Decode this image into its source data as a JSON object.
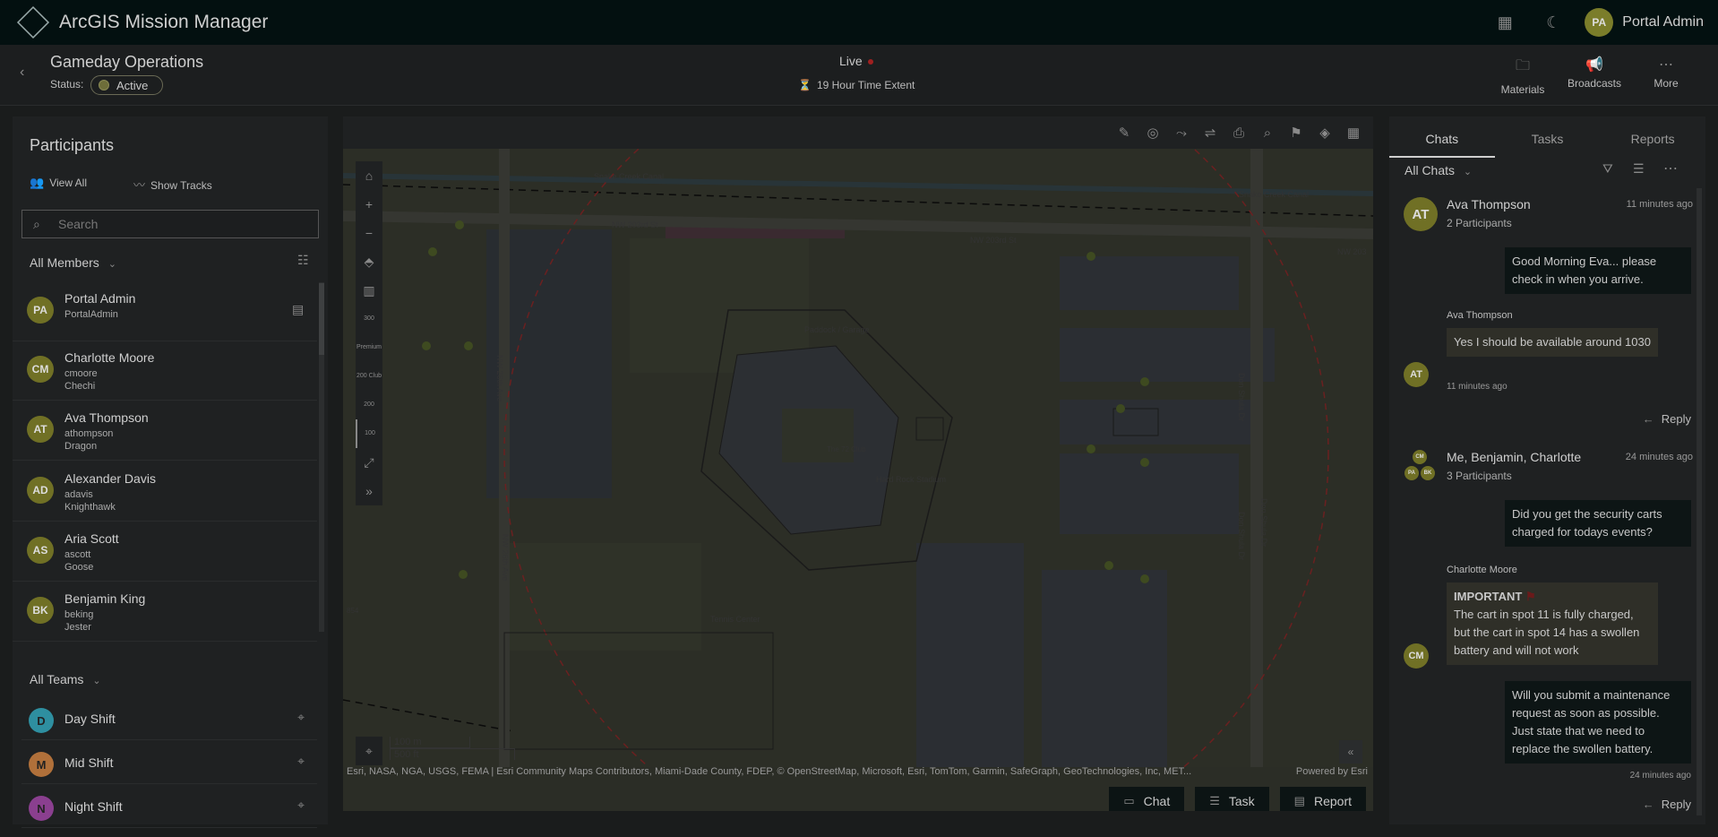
{
  "app": {
    "title": "ArcGIS Mission Manager",
    "user_initials": "PA",
    "user_name": "Portal Admin"
  },
  "mission": {
    "title": "Gameday Operations",
    "status_label": "Status:",
    "status_value": "Active",
    "live_label": "Live",
    "time_extent": "19 Hour Time Extent"
  },
  "sub_actions": [
    {
      "label": "Materials",
      "icon": "folder-icon"
    },
    {
      "label": "Broadcasts",
      "icon": "megaphone-icon"
    },
    {
      "label": "More",
      "icon": "more-icon"
    }
  ],
  "participants": {
    "title": "Participants",
    "view_all": "View All",
    "show_tracks": "Show Tracks",
    "search_placeholder": "Search",
    "filter_label": "All Members",
    "members": [
      {
        "initials": "PA",
        "name": "Portal Admin",
        "user": "PortalAdmin",
        "callsign": ""
      },
      {
        "initials": "CM",
        "name": "Charlotte Moore",
        "user": "cmoore",
        "callsign": "Chechi"
      },
      {
        "initials": "AT",
        "name": "Ava Thompson",
        "user": "athompson",
        "callsign": "Dragon"
      },
      {
        "initials": "AD",
        "name": "Alexander Davis",
        "user": "adavis",
        "callsign": "Knighthawk"
      },
      {
        "initials": "AS",
        "name": "Aria Scott",
        "user": "ascott",
        "callsign": "Goose"
      },
      {
        "initials": "BK",
        "name": "Benjamin King",
        "user": "beking",
        "callsign": "Jester"
      }
    ],
    "teams_label": "All Teams",
    "teams": [
      {
        "initial": "D",
        "name": "Day Shift",
        "color": "#2e8fa0"
      },
      {
        "initial": "M",
        "name": "Mid Shift",
        "color": "#b0703a"
      },
      {
        "initial": "N",
        "name": "Night Shift",
        "color": "#8a3f8f"
      }
    ]
  },
  "map": {
    "attribution": "Esri, NASA, NGA, USGS, FEMA | Esri Community Maps Contributors, Miami-Dade County, FDEP, © OpenStreetMap, Microsoft, Esri, TomTom, Garmin, SafeGraph, GeoTechnologies, Inc, MET...",
    "powered_by": "Powered by Esri",
    "scale_m": "100 m",
    "scale_ft": "500 ft",
    "labels": {
      "canal_1": "Snake Creek Canal",
      "canal_2": "Snake Creek Canal",
      "street_1": "NW 203rd St",
      "street_2": "NW 203rd St",
      "street_3": "NW 203",
      "paddock": "Paddock / Garage",
      "stadium": "Hard Rock Stadium",
      "tennis": "Tennis Center",
      "ave_1": "NW 26th Ave",
      "ave_2": "NW 26th Ave",
      "dr_1": "Don Shula Dr",
      "dr_2": "Don Shula Dr",
      "dr_3": "Don Shula Dr",
      "club": "The 72 Club",
      "road_num": "854"
    },
    "floors": [
      "300",
      "Premium",
      "200 Club",
      "200",
      "100"
    ],
    "buttons": [
      {
        "label": "Chat",
        "icon": "chat-icon"
      },
      {
        "label": "Task",
        "icon": "task-list-icon"
      },
      {
        "label": "Report",
        "icon": "report-icon"
      }
    ]
  },
  "chats": {
    "tabs": [
      "Chats",
      "Tasks",
      "Reports"
    ],
    "filter_label": "All Chats",
    "thread1": {
      "initials": "AT",
      "name": "Ava Thompson",
      "sub": "2 Participants",
      "time": "11 minutes ago",
      "msg_out": "Good Morning Eva... please check in when you arrive.",
      "sender": "Ava Thompson",
      "msg_in": "Yes I should be available around 1030",
      "msg_in_time": "11 minutes ago",
      "reply": "Reply"
    },
    "thread2": {
      "initials": [
        "CM",
        "PA",
        "BK"
      ],
      "name": "Me, Benjamin, Charlotte",
      "sub": "3 Participants",
      "time": "24 minutes ago",
      "msg_out": "Did you get the security carts charged for todays events?",
      "sender": "Charlotte Moore",
      "important": "IMPORTANT",
      "msg_in": "The cart in spot 11 is fully charged, but the cart in spot 14 has a swollen battery and will not work",
      "sender_initials": "CM",
      "msg_out2": "Will you submit a maintenance request as soon as possible. Just state that we need to replace the swollen battery.",
      "msg_out2_time": "24 minutes ago",
      "reply": "Reply"
    }
  }
}
